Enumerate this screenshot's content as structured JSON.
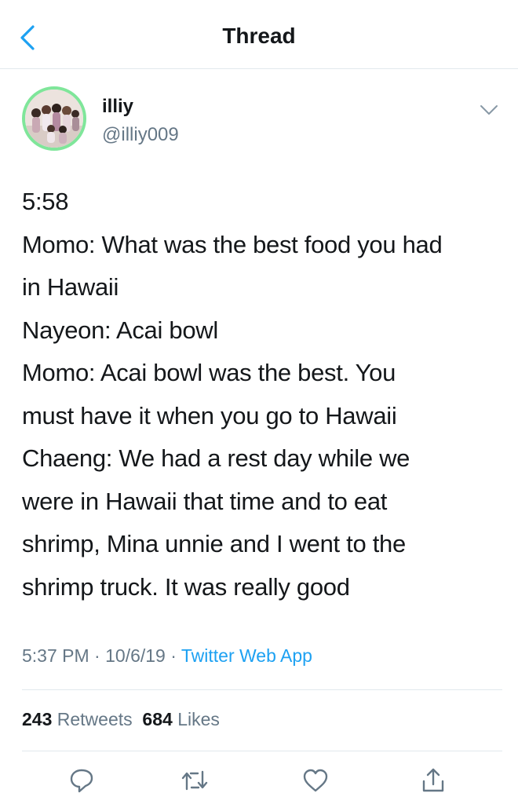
{
  "nav": {
    "title": "Thread"
  },
  "author": {
    "display_name": "illiy",
    "handle": "@illiy009"
  },
  "tweet": {
    "lines": [
      "5:58",
      "Momo: What was the best food you had",
      "in Hawaii",
      "Nayeon: Acai bowl",
      "Momo: Acai bowl was the best. You",
      "must have it when you go to Hawaii",
      "Chaeng: We had a rest day while we",
      "were in Hawaii that time and to eat",
      "shrimp, Mina unnie and I went to the",
      "shrimp truck. It was really good"
    ]
  },
  "meta": {
    "time": "5:37 PM",
    "date": "10/6/19",
    "source": "Twitter Web App",
    "sep": " · "
  },
  "stats": {
    "retweets_count": "243",
    "retweets_label": "Retweets",
    "likes_count": "684",
    "likes_label": "Likes"
  },
  "colors": {
    "accent": "#1da1f2",
    "secondary_text": "#657786",
    "avatar_ring": "#7fe69a"
  },
  "icons": [
    "back-icon",
    "chevron-down-icon",
    "reply-icon",
    "retweet-icon",
    "like-icon",
    "share-icon"
  ]
}
